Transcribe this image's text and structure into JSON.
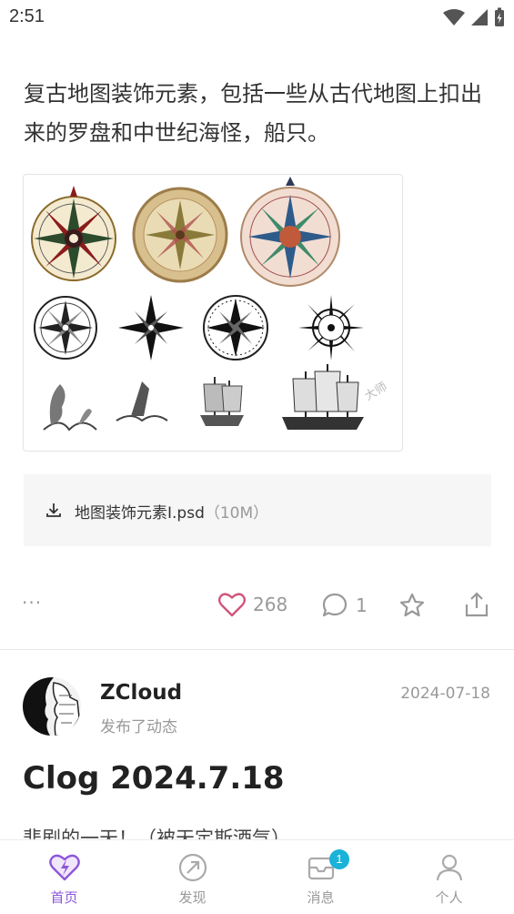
{
  "status_bar": {
    "time": "2:51"
  },
  "post": {
    "text": "复古地图装饰元素，包括一些从古代地图上扣出来的罗盘和中世纪海怪，船只。",
    "watermark": "大师",
    "attachment": {
      "name": "地图装饰元素I.psd",
      "size": "（10M）"
    },
    "actions": {
      "more": "···",
      "likes": "268",
      "comments": "1"
    }
  },
  "next_post": {
    "author": "ZCloud",
    "subtitle": "发布了动态",
    "date": "2024-07-18",
    "title": "Clog 2024.7.18",
    "preview": "悲剧的一天！（被天定斯酒气）"
  },
  "tabbar": {
    "tabs": [
      {
        "label": "首页",
        "icon": "home-heart-icon",
        "active": true
      },
      {
        "label": "发现",
        "icon": "discover-compass-icon",
        "active": false
      },
      {
        "label": "消息",
        "icon": "message-icon",
        "active": false,
        "badge": "1"
      },
      {
        "label": "个人",
        "icon": "person-icon",
        "active": false
      }
    ]
  },
  "colors": {
    "accent": "#8c57d8",
    "like": "#d0557a",
    "badge": "#19b2d8"
  }
}
